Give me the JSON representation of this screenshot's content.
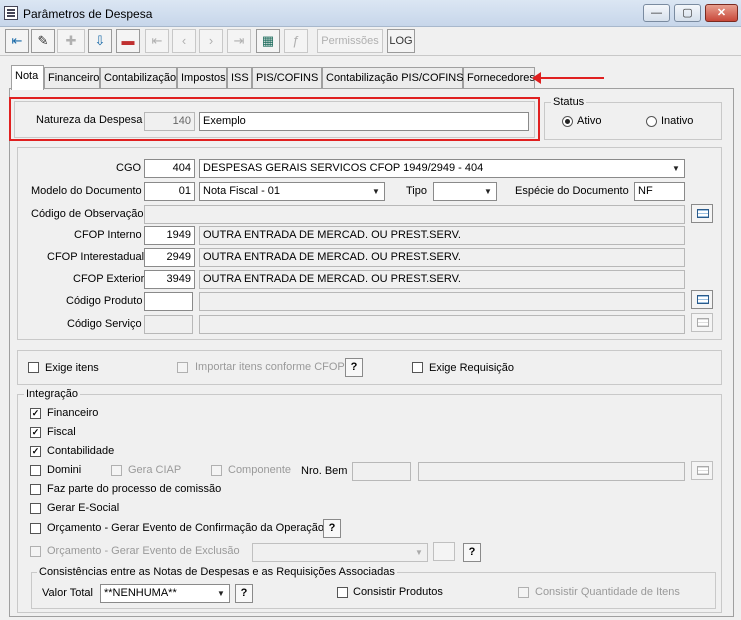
{
  "window": {
    "title": "Parâmetros de Despesa",
    "min": "—",
    "max": "▢",
    "close": "✕"
  },
  "toolbar": {
    "permissoes": "Permissões",
    "log": "LOG"
  },
  "tabs": [
    "Nota",
    "Financeiro",
    "Contabilização",
    "Impostos",
    "ISS",
    "PIS/COFINS",
    "Contabilização PIS/COFINS",
    "Fornecedores"
  ],
  "natureza": {
    "label": "Natureza da Despesa",
    "code": "140",
    "value": "Exemplo"
  },
  "status": {
    "legend": "Status",
    "ativo": "Ativo",
    "inativo": "Inativo",
    "selected": "Ativo"
  },
  "cgo": {
    "label": "CGO",
    "code": "404",
    "value": "DESPESAS GERAIS SERVICOS CFOP 1949/2949 - 404"
  },
  "modelo": {
    "label": "Modelo do Documento",
    "code": "01",
    "value": "Nota Fiscal - 01"
  },
  "tipo": {
    "label": "Tipo",
    "value": ""
  },
  "especie": {
    "label": "Espécie do Documento",
    "value": "NF"
  },
  "observacao": {
    "label": "Código de Observação",
    "value": ""
  },
  "cfop_interno": {
    "label": "CFOP Interno",
    "code": "1949",
    "value": "OUTRA ENTRADA DE MERCAD. OU PREST.SERV."
  },
  "cfop_interestadual": {
    "label": "CFOP Interestadual",
    "code": "2949",
    "value": "OUTRA ENTRADA DE MERCAD. OU PREST.SERV."
  },
  "cfop_exterior": {
    "label": "CFOP Exterior",
    "code": "3949",
    "value": "OUTRA ENTRADA DE MERCAD. OU PREST.SERV."
  },
  "codigo_produto": {
    "label": "Código Produto",
    "code": "",
    "value": ""
  },
  "codigo_servico": {
    "label": "Código Serviço",
    "code": "",
    "value": ""
  },
  "options": {
    "exige_itens": "Exige itens",
    "importar_itens": "Importar itens conforme CFOP",
    "exige_requisicao": "Exige Requisição",
    "help": "?"
  },
  "integracao": {
    "legend": "Integração",
    "financeiro": "Financeiro",
    "fiscal": "Fiscal",
    "contabilidade": "Contabilidade",
    "domini": "Domini",
    "gera_ciap": "Gera CIAP",
    "componente": "Componente",
    "nro_bem": "Nro. Bem",
    "comissao": "Faz parte do processo de comissão",
    "esocial": "Gerar E-Social",
    "orcamento_confirmacao": "Orçamento - Gerar Evento de Confirmação da Operação",
    "orcamento_exclusao": "Orçamento - Gerar Evento de Exclusão",
    "checked_mark": "✓"
  },
  "consistencias": {
    "legend": "Consistências entre as Notas de Despesas e as Requisições Associadas",
    "valor_total_label": "Valor Total",
    "valor_total": "**NENHUMA**",
    "consistir_produtos": "Consistir Produtos",
    "consistir_quantidade": "Consistir Quantidade de Itens"
  },
  "colors": {
    "highlight": "#e02020"
  }
}
